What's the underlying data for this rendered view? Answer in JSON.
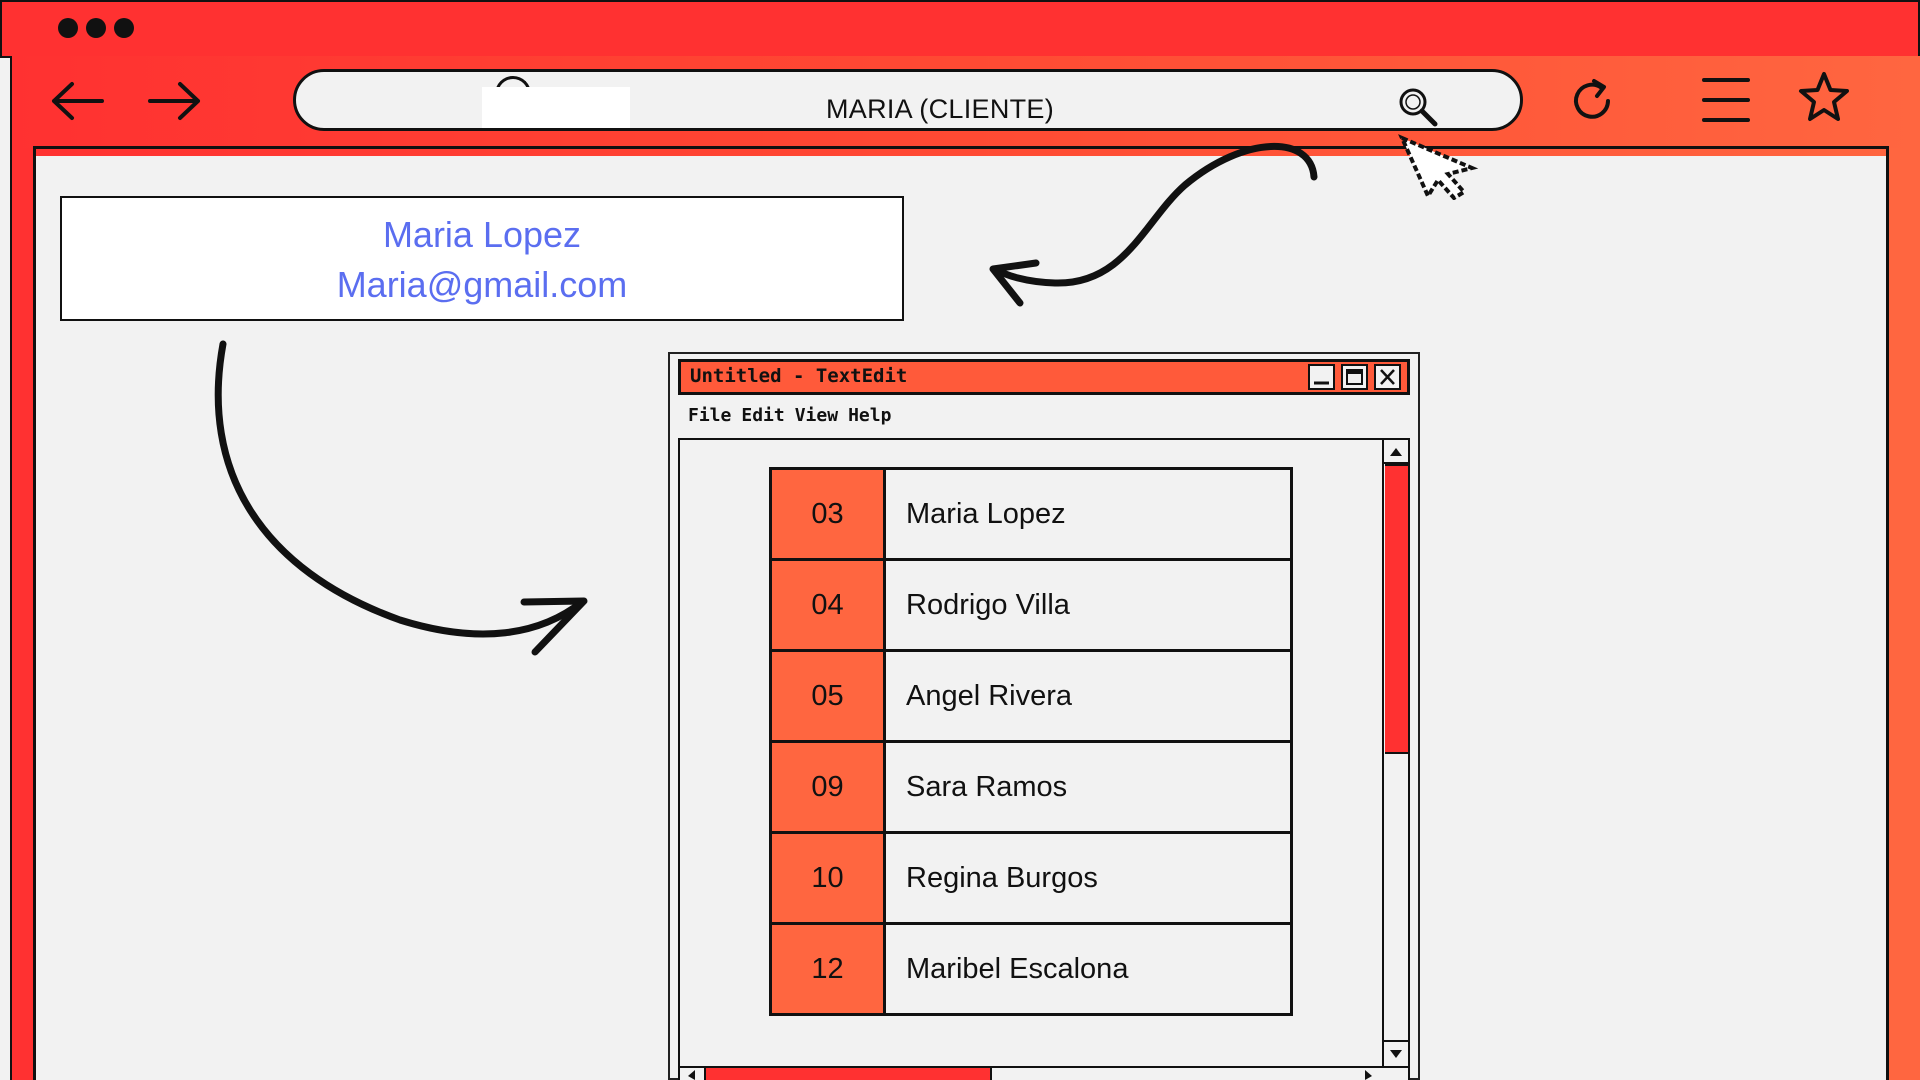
{
  "browser": {
    "address_bar_text": "MARIA (CLIENTE)",
    "colors": {
      "chrome": "#ff3131",
      "accent": "#ff6640",
      "link_text": "#5b6ef0"
    },
    "icons": [
      "back-arrow-icon",
      "forward-arrow-icon",
      "search-icon",
      "reload-icon",
      "menu-icon",
      "star-icon",
      "cursor-icon"
    ]
  },
  "client_card": {
    "name": "Maria Lopez",
    "email": "Maria@gmail.com"
  },
  "textedit": {
    "title": "Untitled - TextEdit",
    "menu": [
      "File",
      "Edit",
      "View",
      "Help"
    ],
    "rows": [
      {
        "id": "03",
        "name": "Maria Lopez"
      },
      {
        "id": "04",
        "name": "Rodrigo Villa"
      },
      {
        "id": "05",
        "name": "Angel Rivera"
      },
      {
        "id": "09",
        "name": "Sara Ramos"
      },
      {
        "id": "10",
        "name": "Regina Burgos"
      },
      {
        "id": "12",
        "name": "Maribel Escalona"
      }
    ]
  }
}
